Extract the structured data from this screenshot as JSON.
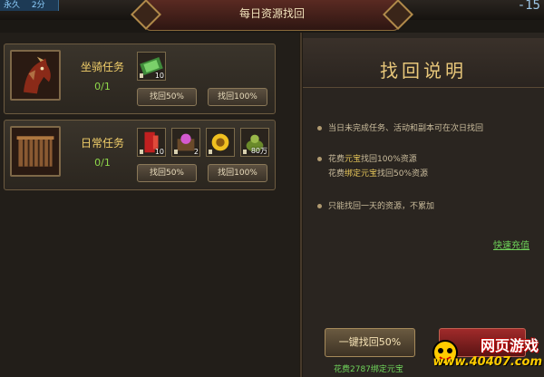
{
  "top": {
    "left_labels": [
      "永久",
      "2分"
    ],
    "right_text": "-15"
  },
  "window": {
    "title": "每日资源找回"
  },
  "tasks": [
    {
      "name": "坐骑任务",
      "progress": "0/1",
      "reward_qty": [
        "10"
      ],
      "btn_50": "找回50%",
      "btn_100": "找回100%"
    },
    {
      "name": "日常任务",
      "progress": "0/1",
      "reward_qty": [
        "10",
        "2",
        "",
        "80万"
      ],
      "btn_50": "找回50%",
      "btn_100": "找回100%"
    }
  ],
  "info": {
    "title": "找回说明",
    "line1": "当日未完成任务、活动和副本可在次日找回",
    "line2a_pre": "花费",
    "line2a_hl": "元宝",
    "line2a_post": "找回100%资源",
    "line2b_pre": "花费",
    "line2b_hl": "绑定元宝",
    "line2b_post": "找回50%资源",
    "line3": "只能找回一天的资源，不累加",
    "recharge_link": "快速充值",
    "onekey_label": "一键找回50%",
    "cost_text": "花费2787绑定元宝"
  },
  "watermark": {
    "line1": "网页游戏",
    "line2": "www.40407.com"
  },
  "colors": {
    "accent_gold": "#f2cf6a",
    "green": "#6fd45a"
  }
}
